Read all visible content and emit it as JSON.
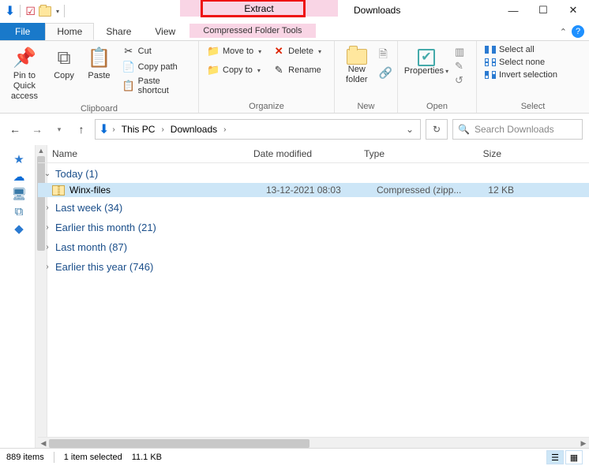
{
  "window": {
    "title": "Downloads"
  },
  "context_tool": {
    "tab": "Extract",
    "group": "Compressed Folder Tools"
  },
  "tabs": {
    "file": "File",
    "home": "Home",
    "share": "Share",
    "view": "View"
  },
  "ribbon": {
    "pin": "Pin to Quick access",
    "copy": "Copy",
    "paste": "Paste",
    "cut": "Cut",
    "copy_path": "Copy path",
    "paste_shortcut": "Paste shortcut",
    "group_clipboard": "Clipboard",
    "move_to": "Move to",
    "copy_to": "Copy to",
    "delete": "Delete",
    "rename": "Rename",
    "group_organize": "Organize",
    "new_folder": "New folder",
    "group_new": "New",
    "properties": "Properties",
    "group_open": "Open",
    "select_all": "Select all",
    "select_none": "Select none",
    "invert_selection": "Invert selection",
    "group_select": "Select"
  },
  "breadcrumb": {
    "root": "This PC",
    "folder": "Downloads"
  },
  "search_placeholder": "Search Downloads",
  "columns": {
    "name": "Name",
    "date": "Date modified",
    "type": "Type",
    "size": "Size"
  },
  "groups": {
    "today": "Today (1)",
    "last_week": "Last week (34)",
    "earlier_month": "Earlier this month (21)",
    "last_month": "Last month (87)",
    "earlier_year": "Earlier this year (746)"
  },
  "file": {
    "name": "Winx-files",
    "date": "13-12-2021 08:03",
    "type": "Compressed (zipp...",
    "size": "12 KB"
  },
  "status": {
    "items": "889 items",
    "selected": "1 item selected",
    "size": "11.1 KB"
  }
}
